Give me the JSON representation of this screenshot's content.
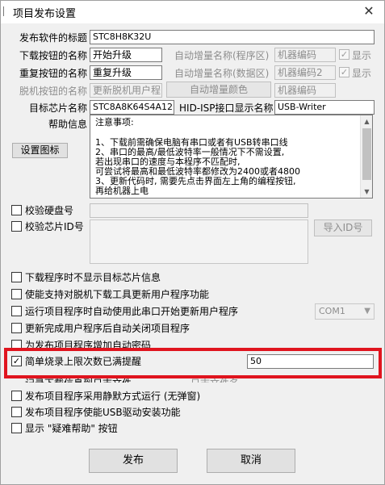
{
  "window": {
    "title": "项目发布设置",
    "close_glyph": "✕"
  },
  "rows": {
    "software_title": {
      "label": "发布软件的标题",
      "value": "STC8H8K32U"
    },
    "download_btn": {
      "label": "下载按钮的名称",
      "value": "开始升级",
      "auto_label": "自动增量名称(程序区)",
      "auto_value": "机器编码",
      "show_label": "显示",
      "show_checked": true
    },
    "repeat_btn": {
      "label": "重复按钮的名称",
      "value": "重复升级",
      "auto_label": "自动增量名称(数据区)",
      "auto_value": "机器编码2",
      "show_label": "显示",
      "show_checked": true
    },
    "offline_btn": {
      "label": "脱机按钮的名称",
      "value": "更新脱机用户程",
      "color_button": "自动增量颜色",
      "auto_value": "机器编码"
    },
    "target_chip": {
      "label": "目标芯片名称",
      "value": "STC8A8K64S4A12",
      "hid_label": "HID-ISP接口显示名称",
      "hid_value": "USB-Writer"
    },
    "help": {
      "label": "帮助信息",
      "set_icon_button": "设置图标",
      "lines": [
        "注意事项:",
        "    1、下载前需确保电脑有串口或者有USB转串口线",
        "    2、串口的最高/最低波特率一般情况下不需设置,",
        "        若出现串口的速度与本程序不匹配时,",
        "        可尝试将最高和最低波特率都修改为2400或者4800",
        "    3、更新代码时, 需要先点击界面左上角的编程按钮,",
        "        再给机器上电"
      ]
    },
    "verify_disk": {
      "label": "校验硬盘号",
      "checked": false
    },
    "verify_chip": {
      "label": "校验芯片ID号",
      "checked": false,
      "import_button": "导入ID号"
    }
  },
  "options": [
    {
      "label": "下载程序时不显示目标芯片信息",
      "checked": false,
      "disabled": false
    },
    {
      "label": "使能支持对脱机下载工具更新用户程序功能",
      "checked": false,
      "disabled": false
    },
    {
      "label": "运行项目程序时自动使用此串口开始更新用户程序",
      "checked": false,
      "disabled": false,
      "combo": "COM1"
    },
    {
      "label": "更新完成用户程序后自动关闭项目程序",
      "checked": false,
      "disabled": false
    },
    {
      "label": "为发布项目程序增加自动密码",
      "checked": false,
      "disabled": false
    },
    {
      "label": "简单烧录上限次数已满提醒",
      "checked": true,
      "disabled": false,
      "value": "50"
    },
    {
      "label": "记录下载信息到日志文件",
      "checked": false,
      "disabled": false,
      "side_label": "日志文件名"
    },
    {
      "label": "发布项目程序采用静默方式运行 (无弹窗)",
      "checked": false,
      "disabled": false
    },
    {
      "label": "发布项目程序使能USB驱动安装功能",
      "checked": false,
      "disabled": false
    },
    {
      "label": "显示 \"疑难帮助\" 按钮",
      "checked": false,
      "disabled": false
    }
  ],
  "footer": {
    "publish": "发布",
    "cancel": "取消"
  },
  "colors": {
    "highlight": "#e0141e"
  }
}
